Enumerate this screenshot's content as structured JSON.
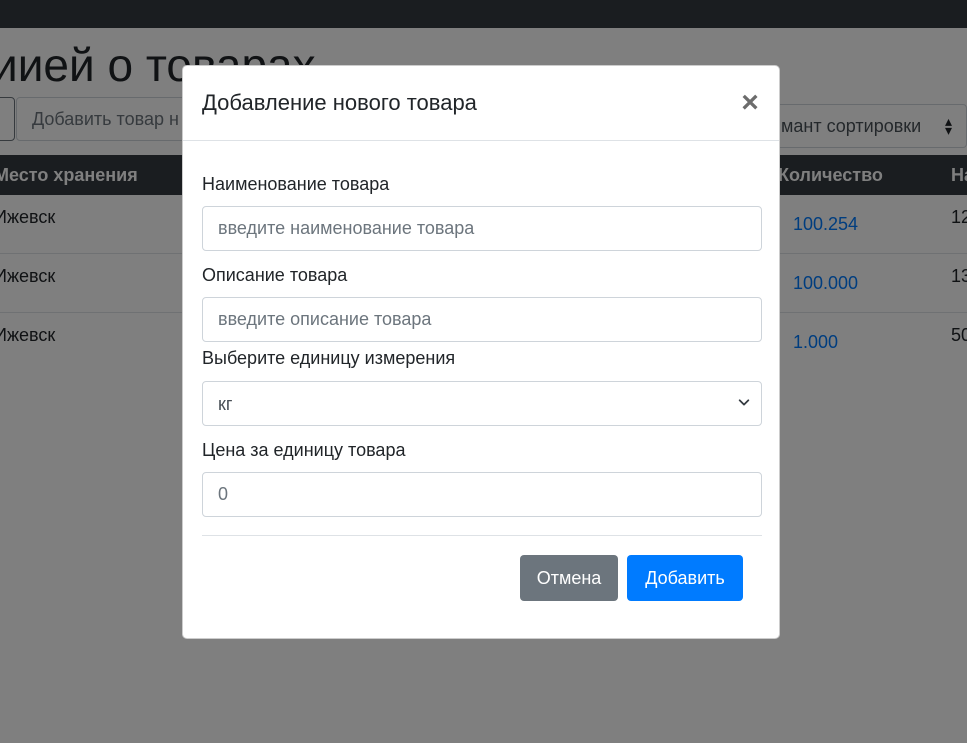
{
  "background": {
    "page_heading": "иией о товарах",
    "add_product_placeholder": "Добавить товар н",
    "sort_select_value": "мант сортировки",
    "table": {
      "headers": {
        "storage": "Место хранения",
        "quantity": "Количество",
        "extra": "На"
      },
      "rows": [
        {
          "city": "Ижевск",
          "quantity": "100.254",
          "extra": "12"
        },
        {
          "city": "Ижевск",
          "quantity": "100.000",
          "extra": "13"
        },
        {
          "city": "Ижевск",
          "quantity": "1.000",
          "extra": "50"
        }
      ]
    }
  },
  "modal": {
    "title": "Добавление нового товара",
    "close_label": "×",
    "fields": {
      "name": {
        "label": "Наименование товара",
        "placeholder": "введите наименование товара",
        "value": ""
      },
      "description": {
        "label": "Описание товара",
        "placeholder": "введите описание товара",
        "value": ""
      },
      "unit": {
        "label": "Выберите единицу измерения",
        "selected": "кг"
      },
      "price": {
        "label": "Цена за единицу товара",
        "placeholder": "0",
        "value": ""
      }
    },
    "buttons": {
      "cancel": "Отмена",
      "add": "Добавить"
    }
  },
  "colors": {
    "primary": "#007bff",
    "secondary": "#6c757d",
    "dark": "#343a40",
    "backdrop": "rgba(0,0,0,0.5)"
  },
  "icons": {
    "close": "close-icon",
    "select_arrow": "chevron-down-icon",
    "sort_arrows": "sort-updown-icon"
  }
}
